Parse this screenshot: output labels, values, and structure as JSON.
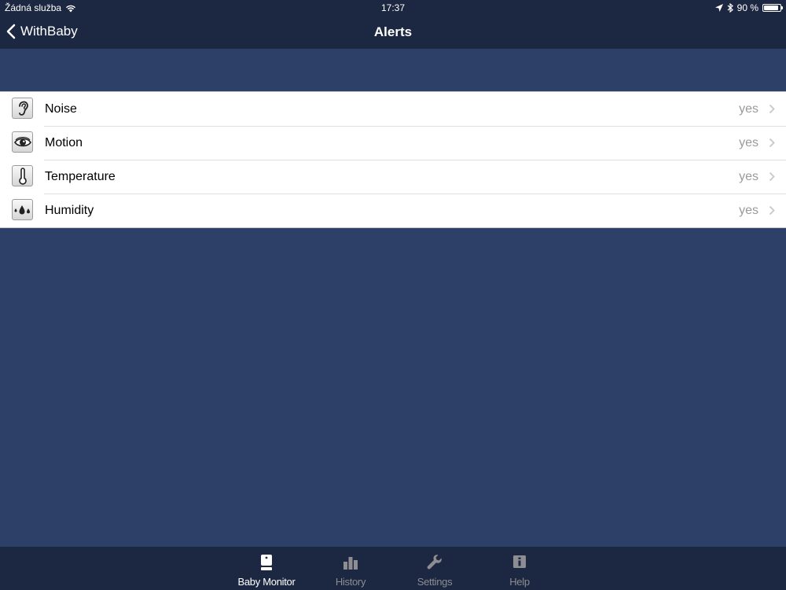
{
  "status_bar": {
    "carrier": "Žádná služba",
    "time": "17:37",
    "battery_text": "90 %",
    "battery_level": 0.9
  },
  "nav": {
    "back_label": "WithBaby",
    "title": "Alerts"
  },
  "alerts": [
    {
      "icon": "ear-icon",
      "label": "Noise",
      "value": "yes"
    },
    {
      "icon": "eye-icon",
      "label": "Motion",
      "value": "yes"
    },
    {
      "icon": "thermometer-icon",
      "label": "Temperature",
      "value": "yes"
    },
    {
      "icon": "droplets-icon",
      "label": "Humidity",
      "value": "yes"
    }
  ],
  "tabbar": {
    "tabs": [
      {
        "label": "Baby Monitor",
        "icon": "baby-monitor-icon",
        "active": true
      },
      {
        "label": "History",
        "icon": "bar-chart-icon",
        "active": false
      },
      {
        "label": "Settings",
        "icon": "wrench-icon",
        "active": false
      },
      {
        "label": "Help",
        "icon": "info-icon",
        "active": false
      }
    ]
  },
  "colors": {
    "bar_background": "#1c2841",
    "content_background": "#2d4068",
    "active_tab": "#ffffff",
    "inactive_tab": "#8d8d92",
    "detail_text": "#9a9a9e"
  }
}
